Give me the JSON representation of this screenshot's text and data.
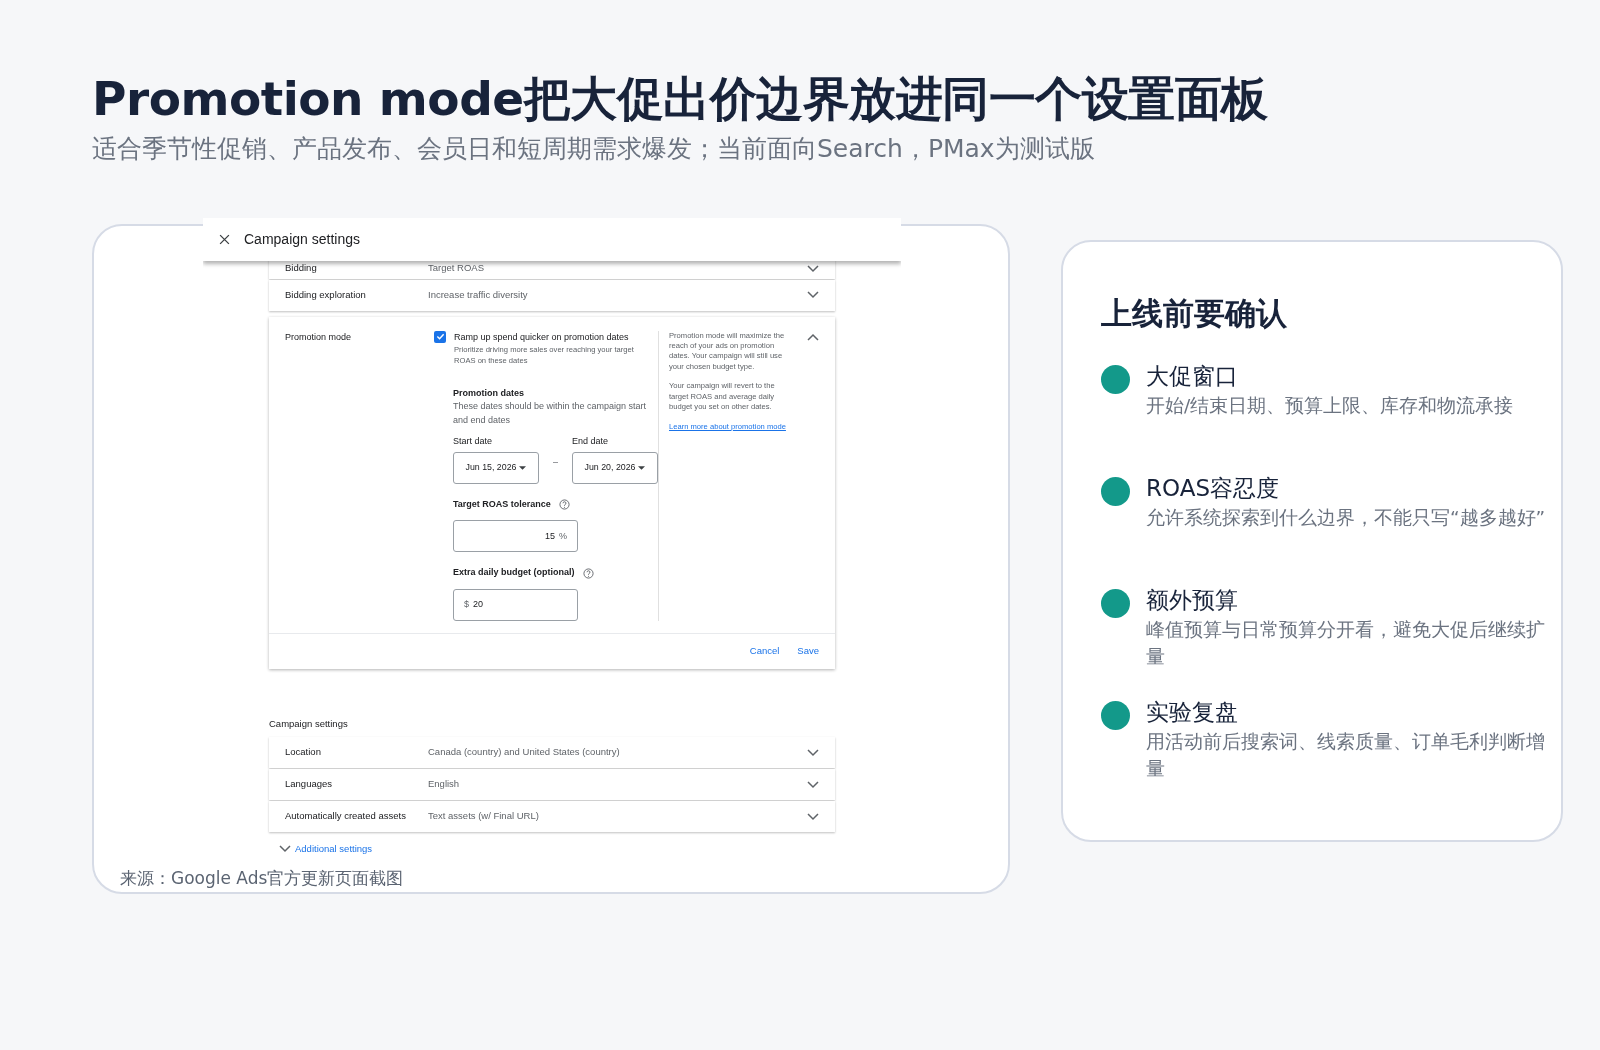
{
  "slide": {
    "title": "Promotion mode把大促出价边界放进同一个设置面板",
    "subtitle": "适合季节性促销、产品发布、会员日和短周期需求爆发；当前面向Search，PMax为测试版"
  },
  "screenshot": {
    "header": {
      "title": "Campaign settings"
    },
    "top_rows": [
      {
        "label": "Bidding",
        "value": "Target ROAS",
        "expanded": false
      },
      {
        "label": "Bidding exploration",
        "value": "Increase traffic diversity",
        "expanded": false
      }
    ],
    "promotion": {
      "label": "Promotion mode",
      "expanded": true,
      "checkbox": {
        "label": "Ramp up spend quicker on promotion dates",
        "hint": "Prioritize driving more sales over reaching your target ROAS on these dates",
        "checked": true
      },
      "dates_title": "Promotion dates",
      "dates_hint": "These dates should be within the campaign start and end dates",
      "start_label": "Start date",
      "start_value": "Jun 15, 2026",
      "separator": "–",
      "end_label": "End date",
      "end_value": "Jun 20, 2026",
      "roas_label": "Target ROAS tolerance",
      "roas_value": "15",
      "roas_unit": "%",
      "budget_label": "Extra daily budget (optional)",
      "budget_prefix": "$",
      "budget_value": "20",
      "info": [
        "Promotion mode will maximize the reach of your ads on promotion dates. Your campaign will still use your chosen budget type.",
        "Your campaign will revert to the target ROAS and average daily budget you set on other dates."
      ],
      "link": "Learn more about promotion mode",
      "buttons": [
        "Cancel",
        "Save"
      ]
    },
    "section_title": "Campaign settings",
    "rows": [
      {
        "label": "Location",
        "value": "Canada (country) and United States (country)",
        "expanded": false
      },
      {
        "label": "Languages",
        "value": "English",
        "expanded": false
      },
      {
        "label": "Automatically created assets",
        "value": "Text assets (w/ Final URL)",
        "expanded": false
      }
    ],
    "more": "Additional settings"
  },
  "caption": "来源：Google Ads官方更新页面截图",
  "checklist": {
    "title": "上线前要确认",
    "items": [
      {
        "title": "大促窗口",
        "desc": "开始/结束日期、预算上限、库存和物流承接",
        "color": "#13998a"
      },
      {
        "title": "ROAS容忍度",
        "desc": "允许系统探索到什么边界，不能只写“越多越好”",
        "color": "#13998a"
      },
      {
        "title": "额外预算",
        "desc": "峰值预算与日常预算分开看，避免大促后继续扩量",
        "color": "#13998a"
      },
      {
        "title": "实验复盘",
        "desc": "用活动前后搜索词、线索质量、订单毛利判断增量",
        "color": "#13998a"
      }
    ]
  }
}
